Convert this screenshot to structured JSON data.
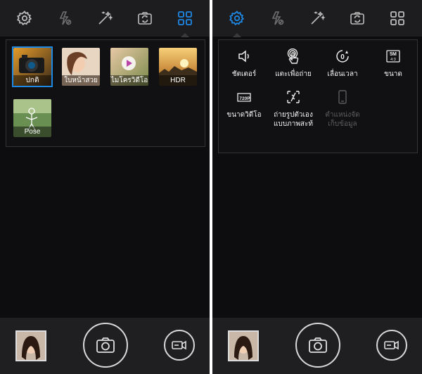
{
  "left_screen": {
    "modes": [
      {
        "label": "ปกติ"
      },
      {
        "label": "ใบหน้าสวย"
      },
      {
        "label": "ไมโครวิดีโอ"
      },
      {
        "label": "HDR"
      },
      {
        "label": "Pose"
      }
    ]
  },
  "right_screen": {
    "settings": [
      {
        "label": "ชัตเตอร์"
      },
      {
        "label": "แตะเพื่อถ่าย"
      },
      {
        "label": "เลื่อนเวลา"
      },
      {
        "label": "ขนาด"
      },
      {
        "label": "ขนาดวิดีโอ"
      },
      {
        "label": "ถ่ายรูปตัวเอง\nแบบภาพสะท้"
      },
      {
        "label": "ตำแหน่งจัด\nเก็บข้อมูล"
      }
    ],
    "icon_text": {
      "timer": "0",
      "size_top": "5M",
      "size_bottom": "4:3",
      "video_size": "720P"
    }
  },
  "colors": {
    "accent": "#1e88e5",
    "icon": "#bdbdbd"
  }
}
